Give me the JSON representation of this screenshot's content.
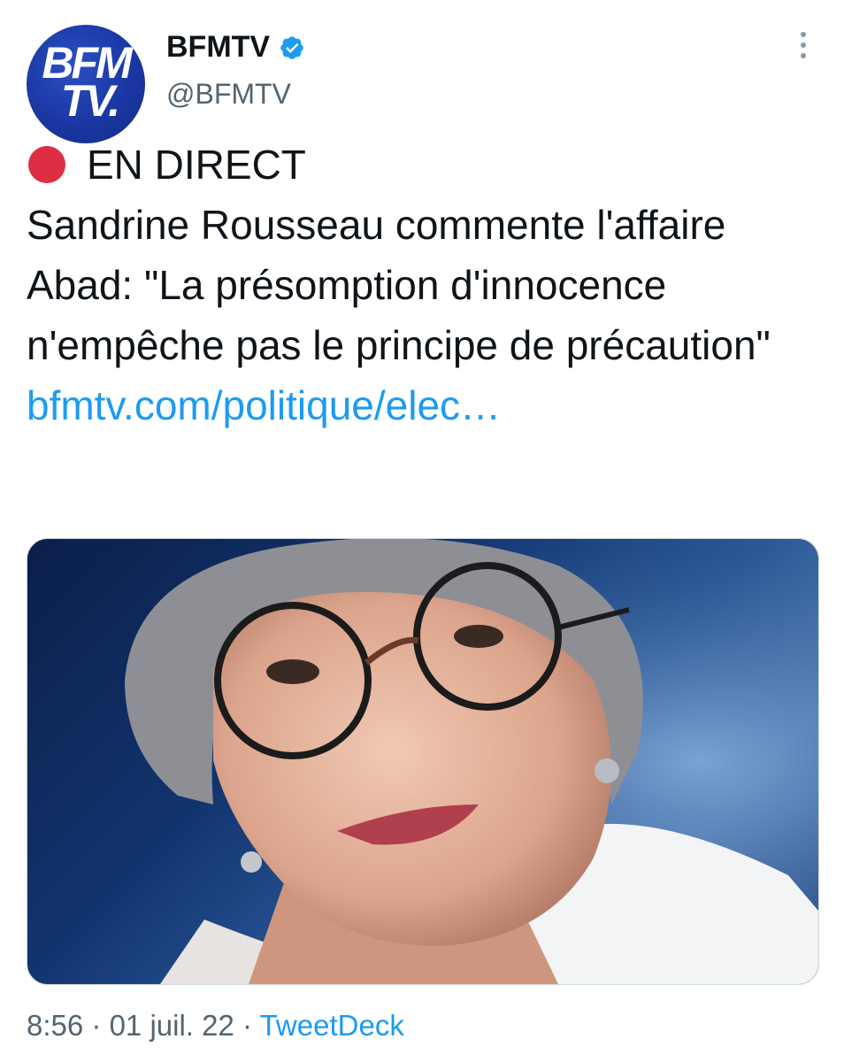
{
  "account": {
    "avatar_text_line1": "BFM",
    "avatar_text_line2": "TV.",
    "display_name": "BFMTV",
    "handle": "@BFMTV",
    "verified": true
  },
  "tweet": {
    "live_label": "EN DIRECT",
    "text": "Sandrine Rousseau commente l'affaire Abad: \"La présomption d'innocence n'empêche pas le principe de précaution\"",
    "link": "bfmtv.com/politique/elec…"
  },
  "media": {
    "description_icon": "photo-portrait"
  },
  "meta": {
    "time": "8:56",
    "separator": "·",
    "date": "01 juil. 22",
    "source": "TweetDeck"
  },
  "colors": {
    "accent": "#1d9bf0",
    "live_dot": "#dd2e44",
    "brand_blue": "#1b37a3",
    "secondary_text": "#536471"
  }
}
